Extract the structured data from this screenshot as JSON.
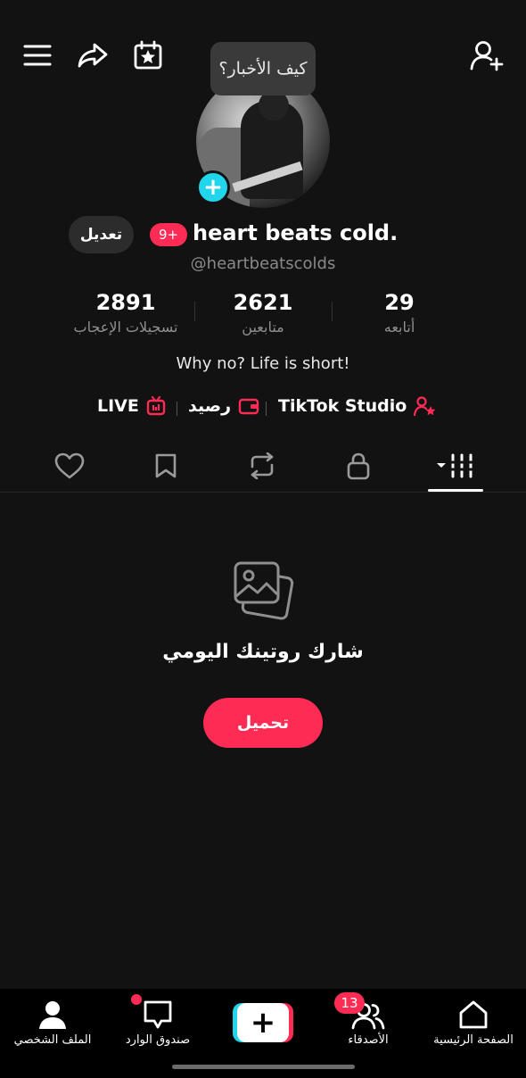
{
  "header": {
    "menu_icon": "hamburger-menu-icon",
    "share_icon": "share-arrow-icon",
    "calendar_icon": "calendar-star-icon",
    "add_friend_icon": "add-person-icon"
  },
  "profile": {
    "status_bubble": "كيف الأخبار؟",
    "edit_label": "تعديل",
    "notification_badge": "9+",
    "display_name": "heart beats cold.",
    "username": "@heartbeatscolds",
    "bio": "Why no? Life is short!"
  },
  "stats": [
    {
      "value": "2891",
      "label": "تسجيلات الإعجاب"
    },
    {
      "value": "2621",
      "label": "متابعين"
    },
    {
      "value": "29",
      "label": "أتابعه"
    }
  ],
  "links": {
    "live": "LIVE",
    "balance": "رصيد",
    "studio": "TikTok Studio"
  },
  "tabs": [
    {
      "icon": "heart-icon"
    },
    {
      "icon": "bookmark-icon"
    },
    {
      "icon": "repost-icon"
    },
    {
      "icon": "lock-icon"
    },
    {
      "icon": "grid-icon",
      "active": true
    }
  ],
  "empty_state": {
    "icon": "photos-icon",
    "title": "شارك روتينك اليومي",
    "button": "تحميل"
  },
  "bottom_nav": {
    "profile": "الملف الشخصي",
    "inbox": "صندوق الوارد",
    "friends": "الأصدقاء",
    "friends_count": "13",
    "home": "الصفحة الرئيسية"
  },
  "colors": {
    "background": "#121212",
    "accent": "#fe2c55",
    "cyan": "#20d5ec",
    "muted_text": "#8a8a8a"
  }
}
